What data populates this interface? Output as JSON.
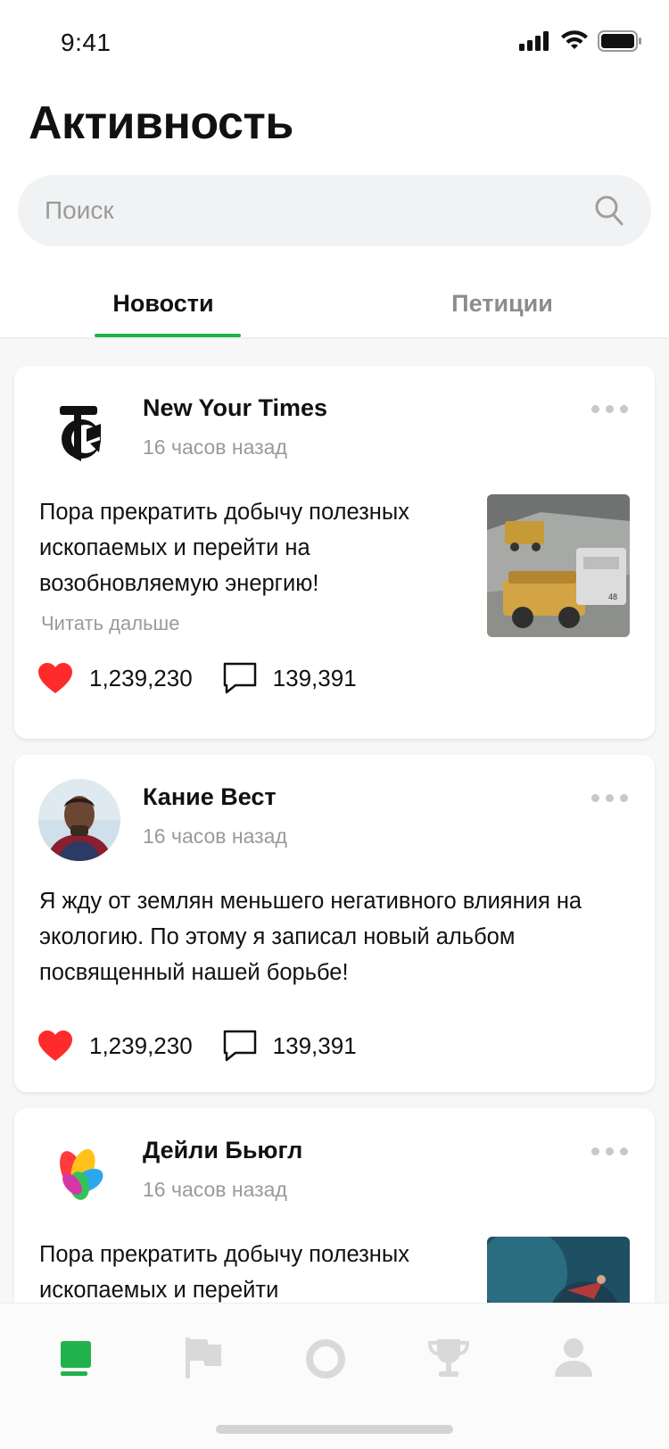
{
  "status_bar": {
    "time": "9:41"
  },
  "header": {
    "title": "Активность"
  },
  "search": {
    "placeholder": "Поиск"
  },
  "tabs": [
    {
      "label": "Новости",
      "active": true
    },
    {
      "label": "Петиции",
      "active": false
    }
  ],
  "colors": {
    "accent": "#22b24c",
    "like": "#ff2b2b",
    "muted": "#9a9a9a",
    "inactive_icon": "#d9d9d9"
  },
  "posts": [
    {
      "author": "New Your Times",
      "time": "16 часов назад",
      "text": "Пора прекратить добычу полезных ископаемых и перейти на возобновляемую энергию!",
      "read_more": "Читать дальше",
      "likes": "1,239,230",
      "comments": "139,391",
      "avatar_icon": "nyt-logo-icon"
    },
    {
      "author": "Кание Вест",
      "time": "16 часов назад",
      "text": "Я жду от землян меньшего негативного влияния на экологию. По этому я записал новый альбом посвященный нашей борьбе!",
      "likes": "1,239,230",
      "comments": "139,391",
      "avatar_icon": "person-photo"
    },
    {
      "author": "Дейли Бьюгл",
      "time": "16 часов назад",
      "text": "Пора прекратить добычу полезных ископаемых и перейти",
      "avatar_icon": "petal-logo-icon"
    }
  ],
  "bottom_nav": [
    {
      "icon": "news-icon",
      "active": true
    },
    {
      "icon": "flag-icon",
      "active": false
    },
    {
      "icon": "ring-icon",
      "active": false
    },
    {
      "icon": "trophy-icon",
      "active": false
    },
    {
      "icon": "profile-icon",
      "active": false
    }
  ]
}
